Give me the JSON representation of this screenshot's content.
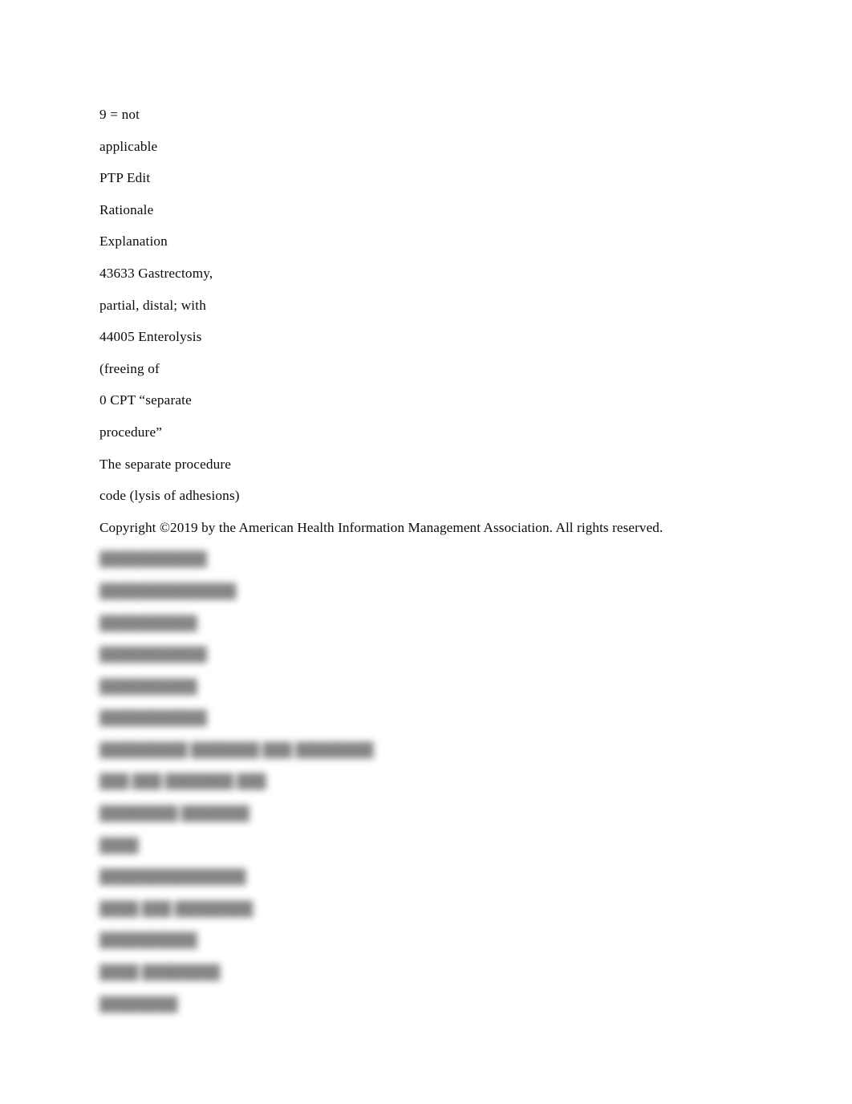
{
  "document": {
    "background_color": "#ffffff",
    "text_color": "#000000",
    "lines": [
      {
        "text": "9 = not"
      },
      {
        "text": "applicable"
      },
      {
        "text": "PTP Edit"
      },
      {
        "text": "Rationale"
      },
      {
        "text": "Explanation"
      },
      {
        "text": "43633 Gastrectomy,"
      },
      {
        "text": "partial, distal; with"
      },
      {
        "text": "44005 Enterolysis"
      },
      {
        "text": "(freeing of"
      },
      {
        "text": "0 CPT “separate"
      },
      {
        "text": "procedure”"
      },
      {
        "text": "The separate procedure"
      },
      {
        "text": "code (lysis of adhesions)"
      }
    ],
    "copyright": "Copyright ©2019 by the American Health Information Management Association. All rights reserved.",
    "obscured_region": {
      "note": "illegible",
      "lines": [
        {
          "text": "███████████"
        },
        {
          "text": "██████████████"
        },
        {
          "text": "██████████"
        },
        {
          "text": "███████████"
        },
        {
          "text": "██████████"
        },
        {
          "text": "███████████"
        },
        {
          "text": "█████████ ███████ ███ ████████"
        },
        {
          "text": "███ ███ ███████ ███"
        },
        {
          "text": "████████ ███████"
        },
        {
          "text": "████"
        },
        {
          "text": "███████████████"
        },
        {
          "text": "████ ███ ████████"
        },
        {
          "text": "██████████"
        },
        {
          "text": "████ ████████"
        },
        {
          "text": "████████"
        }
      ]
    }
  }
}
